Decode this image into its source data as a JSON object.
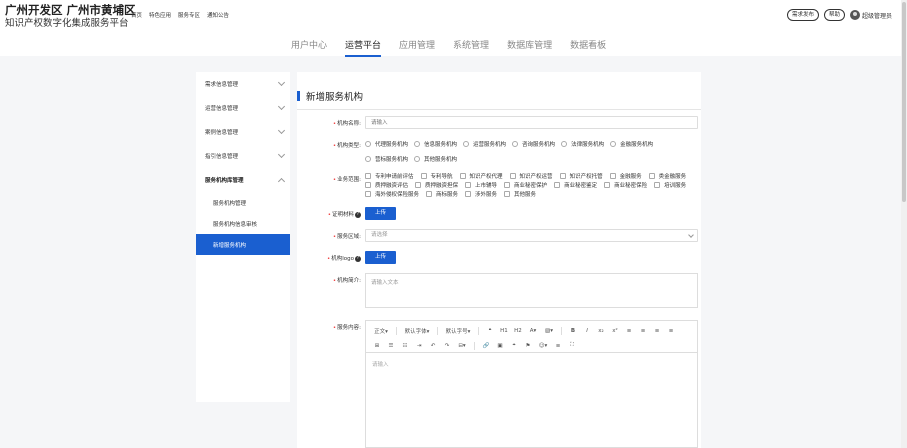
{
  "brand": {
    "title": "广州开发区 广州市黄埔区",
    "subtitle": "知识产权数字化集成服务平台"
  },
  "top_nav": [
    "首页",
    "特色应用",
    "服务专区",
    "通知公告"
  ],
  "header_right": {
    "publish_label": "需求发布",
    "help_label": "帮助",
    "user_name": "超级管理员"
  },
  "main_tabs": [
    {
      "label": "用户中心",
      "active": false
    },
    {
      "label": "运营平台",
      "active": true
    },
    {
      "label": "应用管理",
      "active": false
    },
    {
      "label": "系统管理",
      "active": false
    },
    {
      "label": "数据库管理",
      "active": false
    },
    {
      "label": "数据看板",
      "active": false
    }
  ],
  "sidebar": {
    "items": [
      {
        "label": "需求信息管理",
        "expanded": false
      },
      {
        "label": "运营信息管理",
        "expanded": false
      },
      {
        "label": "案例信息管理",
        "expanded": false
      },
      {
        "label": "指引信息管理",
        "expanded": false
      },
      {
        "label": "服务机构库管理",
        "expanded": true
      }
    ],
    "sub_items": [
      {
        "label": "服务机构管理",
        "active": false
      },
      {
        "label": "服务机构信息审核",
        "active": false
      },
      {
        "label": "新增服务机构",
        "active": true
      }
    ]
  },
  "form": {
    "title": "新增服务机构",
    "name_label": "机构名称:",
    "name_placeholder": "请输入",
    "type_label": "机构类型:",
    "types": [
      "代理服务机构",
      "信息服务机构",
      "运营服务机构",
      "咨询服务机构",
      "法律服务机构",
      "金融服务机构",
      "营标服务机构",
      "其他服务机构"
    ],
    "scope_label": "业务范围:",
    "scopes_row1": [
      "专利申请前评估",
      "专利导航",
      "知识产权代理",
      "知识产权运营",
      "知识产权托管",
      "金融服务",
      "类金融服务"
    ],
    "scopes_row2": [
      "质押融资评估",
      "质押融资担保",
      "上市辅导",
      "商业秘密保护",
      "商业秘密鉴定",
      "商业秘密保险",
      "培训服务"
    ],
    "scopes_row3": [
      "海外侵权保险服务",
      "商标服务",
      "涉外服务",
      "其他服务"
    ],
    "proof_label": "证明材料",
    "upload_label": "上传",
    "region_label": "服务区域:",
    "region_placeholder": "请选择",
    "logo_label": "机构logo",
    "intro_label": "机构简介:",
    "intro_placeholder": "请输入文本",
    "content_label": "服务内容:",
    "editor_placeholder": "请输入",
    "toolbar_row1": [
      "正文▾",
      "默认字体▾",
      "默认字号▾",
      "❝",
      "H1",
      "H2",
      "A▾",
      "▧▾",
      "B",
      "I",
      "x₂",
      "x²",
      "≡",
      "≡",
      "≡",
      "≡"
    ],
    "toolbar_row2": [
      "⊞",
      "☰",
      "☷",
      "⇥",
      "↶",
      "↷",
      "⊟▾",
      "🔗",
      "▣",
      "⌖",
      "⚑",
      "☺▾",
      "≡",
      "⛶"
    ]
  }
}
